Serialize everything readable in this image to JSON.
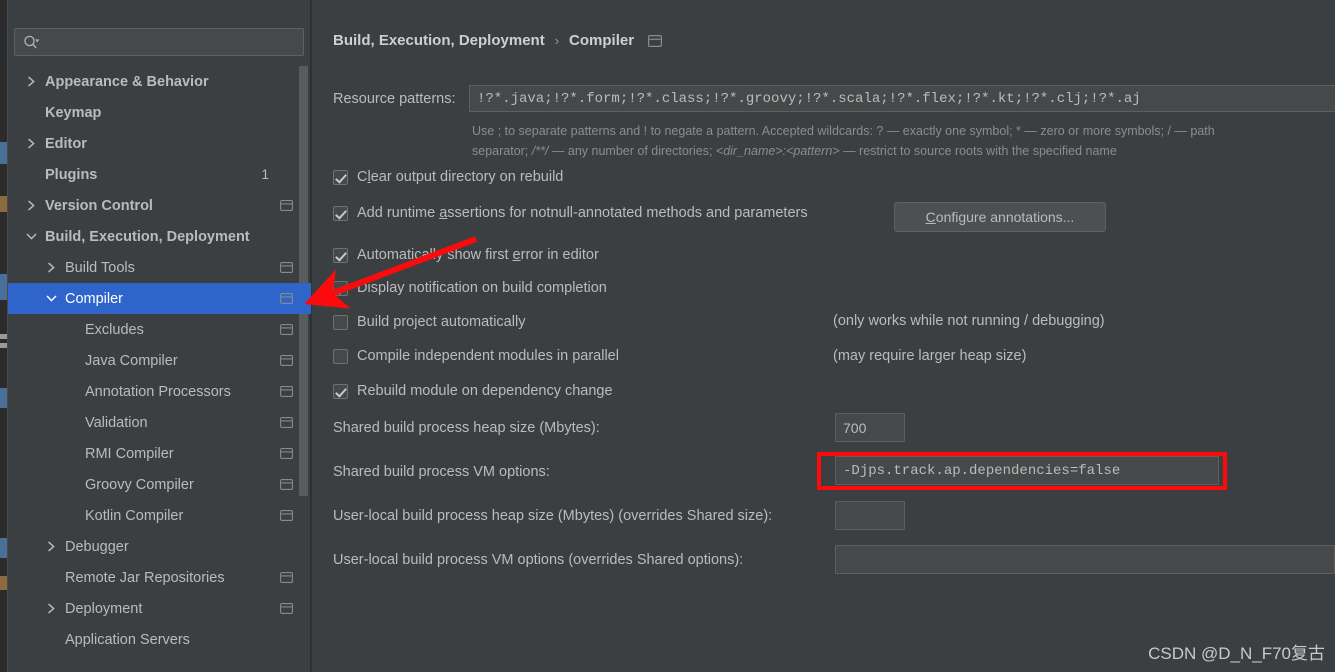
{
  "window": {
    "background_color": "#3c3f41",
    "accent_color": "#2f65ca",
    "annotation_color": "#fb0b0b"
  },
  "search": {
    "placeholder": "",
    "value": "",
    "icon": "search-icon"
  },
  "sidebar": {
    "scrollbar": "visible",
    "items": [
      {
        "label": "Appearance & Behavior",
        "indent": 0,
        "chevron": "right",
        "bold": true,
        "count": "",
        "module_icon": false,
        "selected": false
      },
      {
        "label": "Keymap",
        "indent": 0,
        "chevron": "none",
        "bold": true,
        "count": "",
        "module_icon": false,
        "selected": false
      },
      {
        "label": "Editor",
        "indent": 0,
        "chevron": "right",
        "bold": true,
        "count": "",
        "module_icon": false,
        "selected": false
      },
      {
        "label": "Plugins",
        "indent": 0,
        "chevron": "none",
        "bold": true,
        "count": "1",
        "module_icon": false,
        "selected": false
      },
      {
        "label": "Version Control",
        "indent": 0,
        "chevron": "right",
        "bold": true,
        "count": "",
        "module_icon": true,
        "selected": false
      },
      {
        "label": "Build, Execution, Deployment",
        "indent": 0,
        "chevron": "down",
        "bold": true,
        "count": "",
        "module_icon": false,
        "selected": false
      },
      {
        "label": "Build Tools",
        "indent": 1,
        "chevron": "right",
        "bold": false,
        "count": "",
        "module_icon": true,
        "selected": false
      },
      {
        "label": "Compiler",
        "indent": 1,
        "chevron": "down",
        "bold": false,
        "count": "",
        "module_icon": true,
        "selected": true
      },
      {
        "label": "Excludes",
        "indent": 2,
        "chevron": "none",
        "bold": false,
        "count": "",
        "module_icon": true,
        "selected": false
      },
      {
        "label": "Java Compiler",
        "indent": 2,
        "chevron": "none",
        "bold": false,
        "count": "",
        "module_icon": true,
        "selected": false
      },
      {
        "label": "Annotation Processors",
        "indent": 2,
        "chevron": "none",
        "bold": false,
        "count": "",
        "module_icon": true,
        "selected": false
      },
      {
        "label": "Validation",
        "indent": 2,
        "chevron": "none",
        "bold": false,
        "count": "",
        "module_icon": true,
        "selected": false
      },
      {
        "label": "RMI Compiler",
        "indent": 2,
        "chevron": "none",
        "bold": false,
        "count": "",
        "module_icon": true,
        "selected": false
      },
      {
        "label": "Groovy Compiler",
        "indent": 2,
        "chevron": "none",
        "bold": false,
        "count": "",
        "module_icon": true,
        "selected": false
      },
      {
        "label": "Kotlin Compiler",
        "indent": 2,
        "chevron": "none",
        "bold": false,
        "count": "",
        "module_icon": true,
        "selected": false
      },
      {
        "label": "Debugger",
        "indent": 1,
        "chevron": "right",
        "bold": false,
        "count": "",
        "module_icon": false,
        "selected": false
      },
      {
        "label": "Remote Jar Repositories",
        "indent": 1,
        "chevron": "none",
        "bold": false,
        "count": "",
        "module_icon": true,
        "selected": false
      },
      {
        "label": "Deployment",
        "indent": 1,
        "chevron": "right",
        "bold": false,
        "count": "",
        "module_icon": true,
        "selected": false
      },
      {
        "label": "Application Servers",
        "indent": 1,
        "chevron": "none",
        "bold": false,
        "count": "",
        "module_icon": false,
        "selected": false
      }
    ]
  },
  "breadcrumb": {
    "parent": "Build, Execution, Deployment",
    "separator": "›",
    "current": "Compiler",
    "module_icon": "module-icon"
  },
  "main": {
    "resource_patterns": {
      "label": "Resource patterns:",
      "value": "!?*.java;!?*.form;!?*.class;!?*.groovy;!?*.scala;!?*.flex;!?*.kt;!?*.clj;!?*.aj",
      "hint_line1_a": "Use ; to separate patterns and ! to negate a pattern. Accepted wildcards: ? — exactly one symbol; * — zero or more symbols; / — path",
      "hint_line2_a": "separator; ",
      "hint_line2_i1": "/**/",
      "hint_line2_b": " — any number of directories; ",
      "hint_line2_i2": "<dir_name>:<pattern>",
      "hint_line2_c": " — restrict to source roots with the specified name"
    },
    "checkboxes": [
      {
        "label_pre": "C",
        "mnemonic": "l",
        "label_post": "ear output directory on rebuild",
        "checked": true
      },
      {
        "label_pre": "Add runtime ",
        "mnemonic": "a",
        "label_post": "ssertions for notnull-annotated methods and parameters",
        "checked": true
      },
      {
        "label_pre": "Automatically show first ",
        "mnemonic": "e",
        "label_post": "rror in editor",
        "checked": true
      },
      {
        "label_pre": "Display notification on build completion",
        "mnemonic": "",
        "label_post": "",
        "checked": true
      },
      {
        "label_pre": "Build project automatically",
        "mnemonic": "",
        "label_post": "",
        "checked": false
      },
      {
        "label_pre": "Compile independent modules in parallel",
        "mnemonic": "",
        "label_post": "",
        "checked": false
      },
      {
        "label_pre": "Rebuild module on dependency change",
        "mnemonic": "",
        "label_post": "",
        "checked": true
      }
    ],
    "configure_annotations_button": {
      "mnemonic": "C",
      "label_rest": "onfigure annotations..."
    },
    "notes": {
      "build_auto": "(only works while not running / debugging)",
      "parallel": "(may require larger heap size)"
    },
    "fields": [
      {
        "label": "Shared build process heap size (Mbytes):",
        "value": "700",
        "placeholder": ""
      },
      {
        "label": "Shared build process VM options:",
        "value": "-Djps.track.ap.dependencies=false",
        "placeholder": ""
      },
      {
        "label": "User-local build process heap size (Mbytes) (overrides Shared size):",
        "value": "",
        "placeholder": ""
      },
      {
        "label": "User-local build process VM options (overrides Shared options):",
        "value": "",
        "placeholder": ""
      }
    ]
  },
  "annotations": {
    "arrow": "red-arrow-pointing-to-compiler",
    "highlight_box": "red-rect-around-shared-vm-options",
    "watermark": "CSDN @D_N_F70复古"
  }
}
